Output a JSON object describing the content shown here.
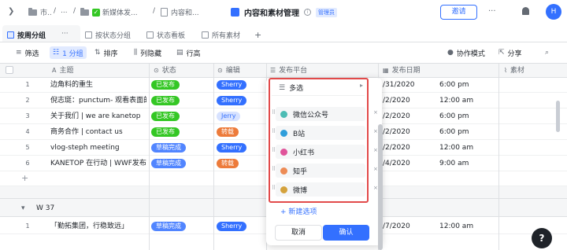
{
  "breadcrumb": {
    "item1": "市..",
    "sep": "/",
    "item2": "...",
    "item3": "新媒体发...",
    "item4": "内容和...",
    "item3_check": "✓"
  },
  "header": {
    "title": "内容和素材管理",
    "admin_badge": "管理员",
    "invite_label": "邀请",
    "more_label": "···",
    "avatar_letter": "H"
  },
  "tabs": [
    {
      "label": "按周分组"
    },
    {
      "label": "按状态分组"
    },
    {
      "label": "状态看板"
    },
    {
      "label": "所有素材"
    }
  ],
  "tabs_more": "···",
  "tabs_add": "+",
  "toolbar": {
    "filter": "筛选",
    "group": "1 分组",
    "sort": "排序",
    "hidden": "列隐藏",
    "row_height": "行高",
    "collab": "协作模式",
    "share": "分享"
  },
  "columns": {
    "title": "主题",
    "status": "状态",
    "editor": "编辑",
    "platform": "发布平台",
    "date": "发布日期",
    "assets": "素材"
  },
  "rows": [
    {
      "num": "1",
      "title": "边角料的重生",
      "status": "已发布",
      "status_color": "green",
      "editor": "Sherry",
      "editor_style": "sherry",
      "date": "/31/2020",
      "time": "6:00 pm"
    },
    {
      "num": "2",
      "title": "倪志珽：punctum- 观看表面的同",
      "status": "已发布",
      "status_color": "green",
      "editor": "Sherry",
      "editor_style": "sherry",
      "date": "/2/2020",
      "time": "12:00 am"
    },
    {
      "num": "3",
      "title": "关于我们 | we are kanetop",
      "status": "已发布",
      "status_color": "green",
      "editor": "Jerry",
      "editor_style": "jerry",
      "date": "/2/2020",
      "time": "6:00 pm"
    },
    {
      "num": "4",
      "title": "商务合作 | contact us",
      "status": "已发布",
      "status_color": "green",
      "editor": "转载",
      "editor_style": "orange",
      "date": "/2/2020",
      "time": "6:00 pm"
    },
    {
      "num": "5",
      "title": "vlog-steph meeting",
      "status": "草稿完成",
      "status_color": "blue",
      "editor": "Sherry",
      "editor_style": "sherry",
      "date": "/2/2020",
      "time": "12:00 am"
    },
    {
      "num": "6",
      "title": "KANETOP 在行动 | WWF发布号",
      "status": "草稿完成",
      "status_color": "blue",
      "editor": "转载",
      "editor_style": "orange",
      "date": "/4/2020",
      "time": "9:00 am"
    }
  ],
  "add_row": "+",
  "group2": {
    "label": "W 37",
    "row": {
      "num": "1",
      "title": "「勤拓集团，行稳致远」",
      "status": "草稿完成",
      "status_color": "blue",
      "editor": "Sherry",
      "editor_style": "sherry",
      "date": "/7/2020",
      "time": "12:00 am"
    }
  },
  "dropdown": {
    "multi_label": "多选",
    "options": [
      {
        "label": "微信公众号",
        "color": "#4cbcb4"
      },
      {
        "label": "B站",
        "color": "#2f9edb"
      },
      {
        "label": "小红书",
        "color": "#e0539a"
      },
      {
        "label": "知乎",
        "color": "#ed8b55"
      },
      {
        "label": "微博",
        "color": "#d4a23c"
      }
    ],
    "new_option": "+ 新建选项",
    "cancel": "取消",
    "confirm": "确认"
  },
  "help": "?"
}
